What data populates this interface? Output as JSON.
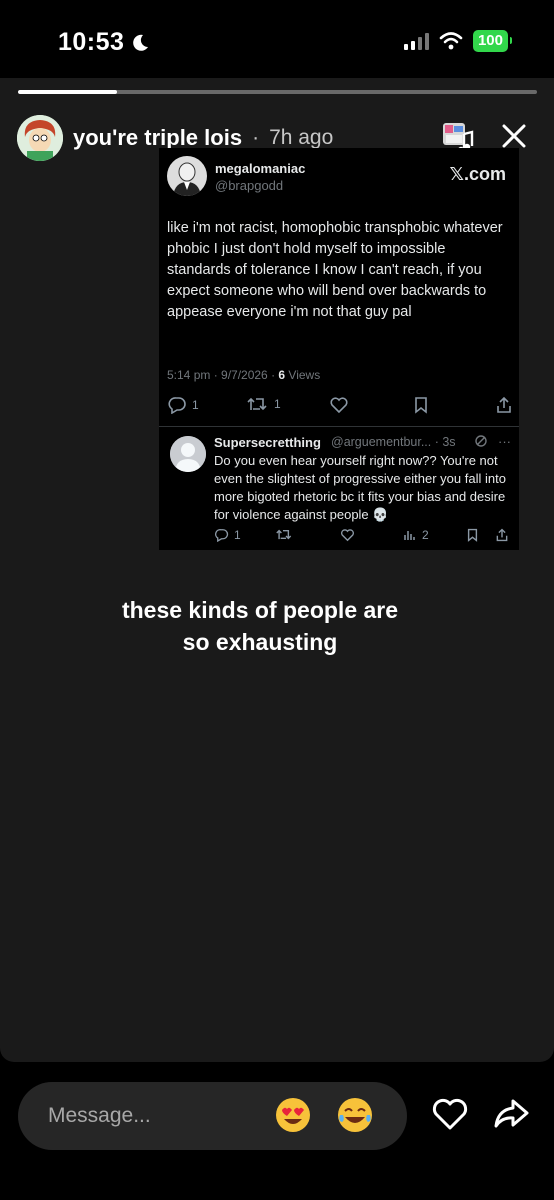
{
  "status_bar": {
    "time": "10:53",
    "battery": "100",
    "colors": {
      "battery": "#32d74b"
    }
  },
  "story": {
    "progress": 0.19,
    "username": "you're triple lois",
    "separator": "·",
    "time_ago": "7h ago",
    "caption_line1": "these kinds of people are",
    "caption_line2": "so exhausting"
  },
  "tweet": {
    "display_name": "megalomaniac",
    "handle": "@brapgodd",
    "source": "𝕏.com",
    "body": "like i'm not racist, homophobic transphobic whatever phobic I just don't hold myself to impossible standards of tolerance I know I can't reach, if you expect someone who will bend over backwards to appease everyone i'm not that guy pal",
    "meta_prefix": "5:14 pm · 9/7/2026 · ",
    "views_count": "6",
    "views_label": " Views",
    "reply_count": "1",
    "repost_count": "1"
  },
  "reply": {
    "display_name": "Supersecretthing",
    "handle": "@arguementbur... · 3s",
    "body": "Do you even hear yourself right now?? You're not even the slightest of progressive either you fall into more bigoted rhetoric bc it fits your bias and desire for violence against people 💀",
    "reply_count": "1",
    "views_count": "2"
  },
  "composer": {
    "placeholder": "Message..."
  },
  "icons": [
    "moon-icon",
    "signal-icon",
    "wifi-icon",
    "music-icon",
    "close-icon",
    "reply-icon",
    "repost-icon",
    "like-icon",
    "bookmark-icon",
    "share-icon",
    "views-icon",
    "heart-eyes-emoji",
    "laughing-emoji",
    "heart-icon",
    "send-icon"
  ]
}
